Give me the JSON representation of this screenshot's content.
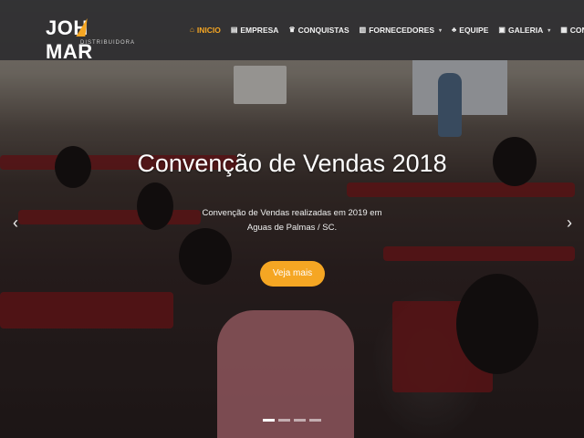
{
  "brand": {
    "name_left": "JOH",
    "name_right": "MAR",
    "subtitle": "DISTRIBUIDORA",
    "accent": "#f5a623"
  },
  "nav": {
    "items": [
      {
        "label": "INICIO",
        "icon": "home-icon",
        "glyph": "⌂",
        "active": true
      },
      {
        "label": "EMPRESA",
        "icon": "document-icon",
        "glyph": "▤"
      },
      {
        "label": "CONQUISTAS",
        "icon": "trophy-icon",
        "glyph": "♛"
      },
      {
        "label": "FORNECEDORES",
        "icon": "chart-icon",
        "glyph": "▥",
        "dropdown": true
      },
      {
        "label": "EQUIPE",
        "icon": "team-icon",
        "glyph": "♣"
      },
      {
        "label": "GALERIA",
        "icon": "gallery-icon",
        "glyph": "▣",
        "dropdown": true
      },
      {
        "label": "CONTATO",
        "icon": "contact-icon",
        "glyph": "▦"
      }
    ]
  },
  "slide": {
    "title": "Convenção de Vendas 2018",
    "description": "Convenção de Vendas realizadas em 2019 em Aguas de Palmas / SC.",
    "button": "Veja mais",
    "prev_glyph": "‹",
    "next_glyph": "›"
  },
  "slider": {
    "count": 4,
    "active_index": 0
  }
}
